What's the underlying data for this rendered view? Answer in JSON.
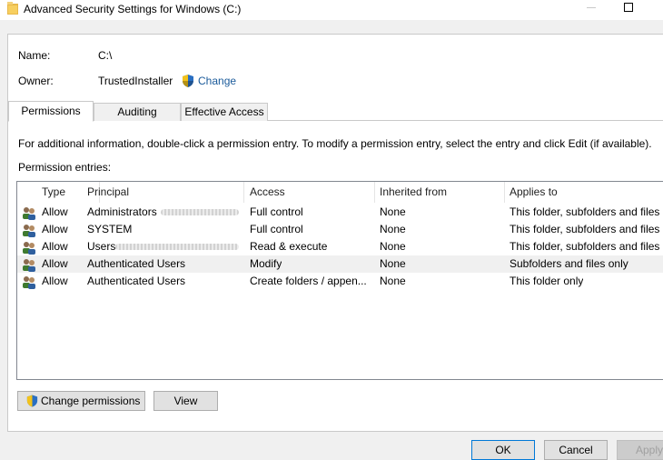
{
  "window": {
    "title": "Advanced Security Settings for Windows (C:)",
    "icon": "folder-icon",
    "controls": [
      "minimize-icon",
      "maximize-icon"
    ]
  },
  "properties": {
    "name_label": "Name:",
    "name_value": "C:\\",
    "owner_label": "Owner:",
    "owner_value": "TrustedInstaller",
    "change_link": "Change",
    "shield_icon": "uac-shield-icon"
  },
  "tabs": [
    {
      "label": "Permissions",
      "active": true
    },
    {
      "label": "Auditing",
      "active": false
    },
    {
      "label": "Effective Access",
      "active": false
    }
  ],
  "info_text": "For additional information, double-click a permission entry. To modify a permission entry, select the entry and click Edit (if available).",
  "entries_label": "Permission entries:",
  "table": {
    "columns": [
      "Type",
      "Principal",
      "Access",
      "Inherited from",
      "Applies to"
    ],
    "rows": [
      {
        "type": "Allow",
        "principal": "Administrators",
        "access": "Full control",
        "inherited": "None",
        "applies": "This folder, subfolders and files",
        "redacted": true,
        "highlighted": false
      },
      {
        "type": "Allow",
        "principal": "SYSTEM",
        "access": "Full control",
        "inherited": "None",
        "applies": "This folder, subfolders and files",
        "redacted": false,
        "highlighted": false
      },
      {
        "type": "Allow",
        "principal": "Users",
        "access": "Read & execute",
        "inherited": "None",
        "applies": "This folder, subfolders and files",
        "redacted": true,
        "highlighted": false
      },
      {
        "type": "Allow",
        "principal": "Authenticated Users",
        "access": "Modify",
        "inherited": "None",
        "applies": "Subfolders and files only",
        "redacted": false,
        "highlighted": true
      },
      {
        "type": "Allow",
        "principal": "Authenticated Users",
        "access": "Create folders / appen...",
        "inherited": "None",
        "applies": "This folder only",
        "redacted": false,
        "highlighted": false
      }
    ]
  },
  "buttons": {
    "change_permissions": "Change permissions",
    "view": "View",
    "ok": "OK",
    "cancel": "Cancel",
    "apply": "Apply"
  },
  "colors": {
    "link": "#1a5a9a",
    "primary_button_border": "#0078d7",
    "highlight_row": "#f0f0f0"
  }
}
